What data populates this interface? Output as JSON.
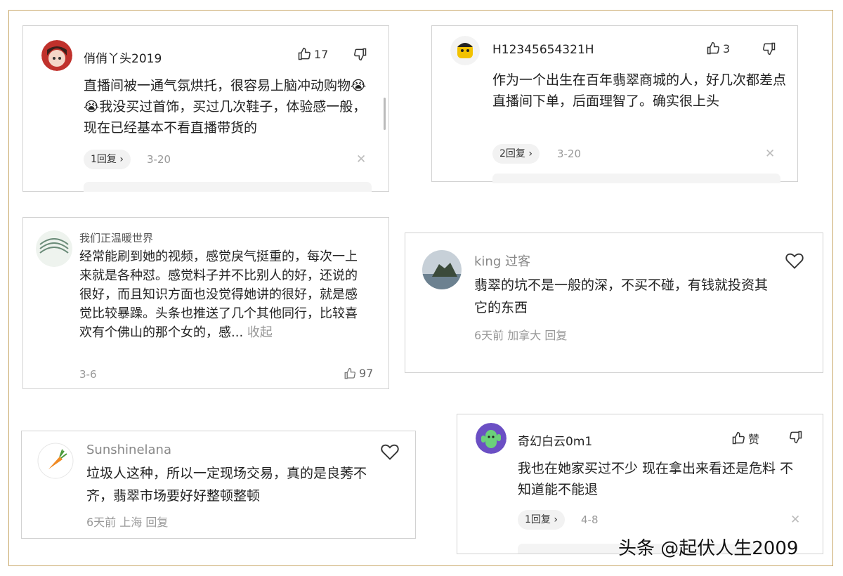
{
  "comments": [
    {
      "user": "俏俏丫头2019",
      "likes": "17",
      "text": "直播间被一通气氛烘托，很容易上脑冲动购物😭😭我没买过首饰，买过几次鞋子，体验感一般，现在已经基本不看直播带货的",
      "reply_label": "1回复 ›",
      "date": "3-20"
    },
    {
      "user": "H12345654321H",
      "likes": "3",
      "text": "作为一个出生在百年翡翠商城的人，好几次都差点直播间下单，后面理智了。确实很上头",
      "reply_label": "2回复 ›",
      "date": "3-20"
    },
    {
      "user": "我们正温暖世界",
      "text": "经常能刷到她的视频，感觉戾气挺重的，每次一上来就是各种怼。感觉料子并不比别人的好，还说的很好，而且知识方面也没觉得她讲的很好，就是感觉比较暴躁。头条也推送了几个其他同行，比较喜欢有个佛山的那个女的，感...",
      "collapse": "收起",
      "date": "3-6",
      "likes": "97"
    },
    {
      "user": "king 过客",
      "text": "翡翠的坑不是一般的深，不买不碰，有钱就投资其它的东西",
      "meta": "6天前 加拿大  回复"
    },
    {
      "user": "Sunshinelana",
      "text": "垃圾人这种，所以一定现场交易，真的是良莠不齐，翡翠市场要好好整顿整顿",
      "meta": "6天前 上海  回复"
    },
    {
      "user": "奇幻白云0m1",
      "likes": "赞",
      "text": "我也在她家买过不少 现在拿出来看还是危料 不知道能不能退",
      "reply_label": "1回复 ›",
      "date": "4-8"
    }
  ],
  "watermark": "头条 @起伏人生2009",
  "colors": {
    "frame": "#c9a86a",
    "border": "#d2d2d2",
    "muted": "#999999"
  },
  "icons": [
    "thumb-up-icon",
    "thumb-down-icon",
    "heart-icon",
    "close-icon"
  ]
}
